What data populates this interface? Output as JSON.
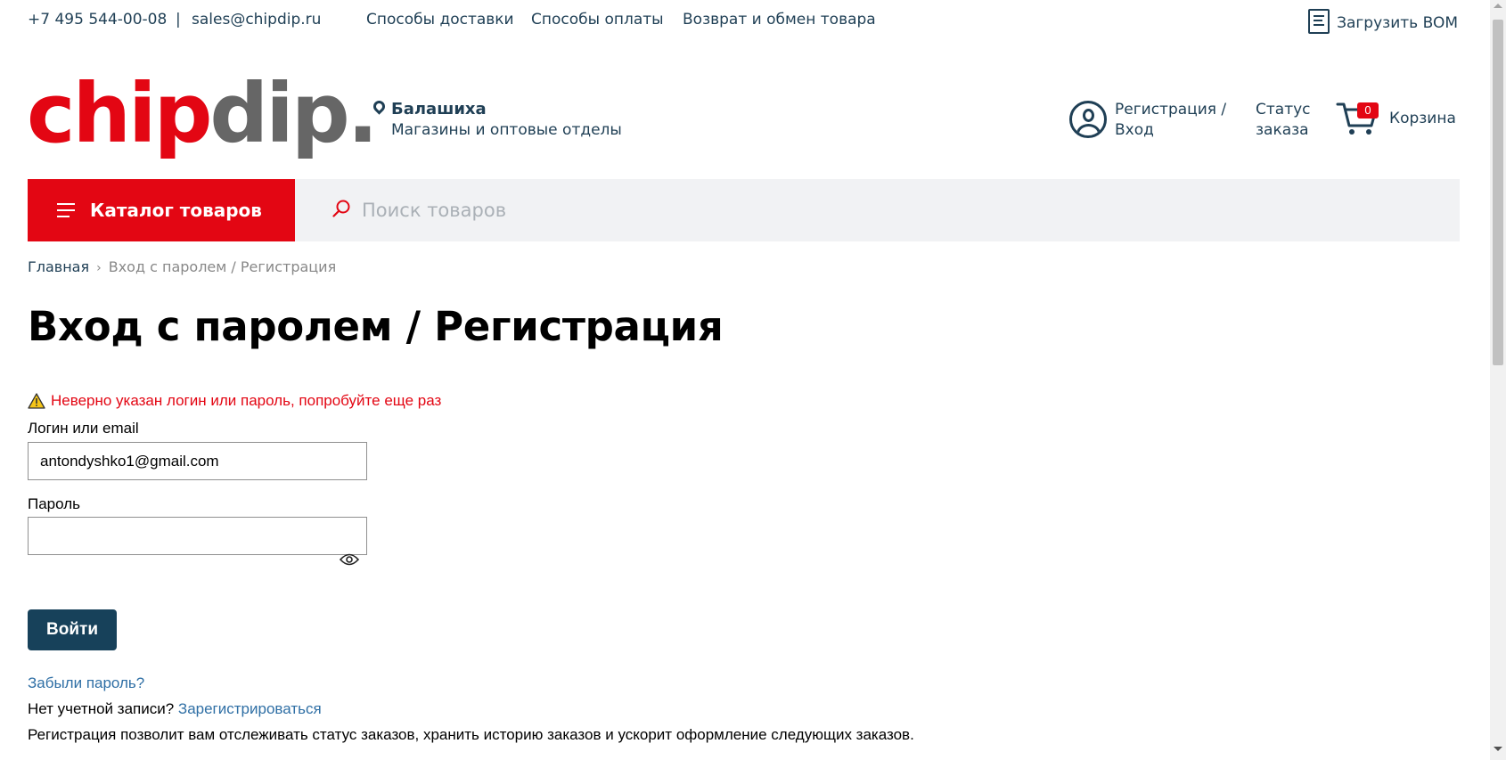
{
  "topbar": {
    "phone": "+7 495 544-00-08",
    "separator": "|",
    "email": "sales@chipdip.ru",
    "links": [
      "Способы доставки",
      "Способы оплаты",
      "Возврат и обмен товара"
    ],
    "bom_label": "Загрузить BOM"
  },
  "header": {
    "logo_chip": "chip",
    "logo_dip": "dip.",
    "city": "Балашиха",
    "stores_link": "Магазины и оптовые отделы",
    "auth_line1": "Регистрация /",
    "auth_line2": "Вход",
    "status_line1": "Статус",
    "status_line2": "заказа",
    "cart_count": "0",
    "cart_label": "Корзина"
  },
  "searchbar": {
    "catalog_label": "Каталог товаров",
    "search_placeholder": "Поиск товаров",
    "search_value": ""
  },
  "breadcrumb": {
    "home": "Главная",
    "arrow": "›",
    "current": "Вход с паролем / Регистрация"
  },
  "page": {
    "title": "Вход с паролем / Регистрация",
    "error": "Неверно указан логин или пароль, попробуйте еще раз"
  },
  "form": {
    "login_label": "Логин или email",
    "login_value": "antondyshko1@gmail.com",
    "password_label": "Пароль",
    "password_value": "",
    "submit_label": "Войти",
    "forgot_link": "Забыли пароль?",
    "no_account_text": "Нет учетной записи?",
    "register_link": "Зарегистрироваться",
    "register_info": "Регистрация позволит вам отслеживать статус заказов, хранить историю заказов и ускорит оформление следующих заказов."
  },
  "colors": {
    "brand_red": "#e30613",
    "brand_gray": "#666666",
    "navy": "#1f3f55",
    "button": "#17415a",
    "link": "#2f6fa5"
  },
  "icons": [
    "document-icon",
    "location-pin-icon",
    "user-icon",
    "cart-icon",
    "menu-icon",
    "search-icon",
    "warning-icon",
    "eye-icon"
  ]
}
